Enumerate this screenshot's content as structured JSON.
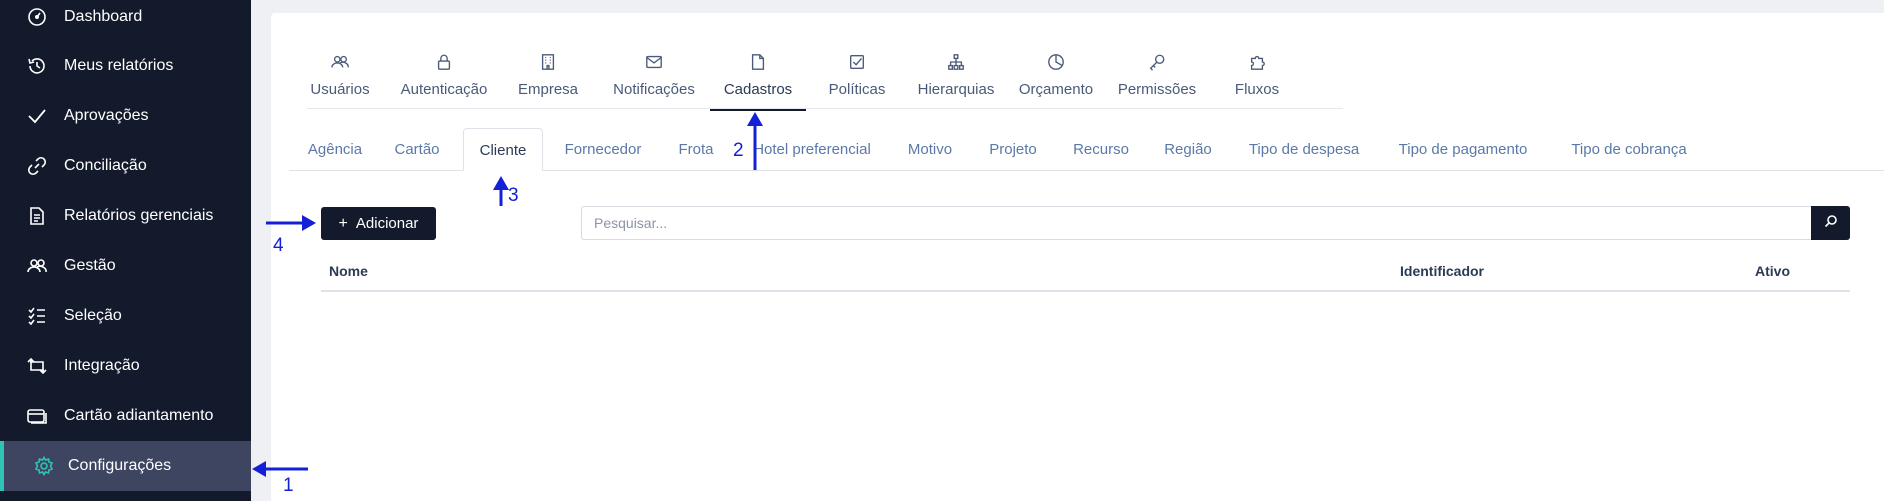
{
  "sidebar": {
    "items": [
      {
        "label": "Dashboard",
        "icon": "dashboard-gauge-icon"
      },
      {
        "label": "Meus relatórios",
        "icon": "history-icon"
      },
      {
        "label": "Aprovações",
        "icon": "check-icon"
      },
      {
        "label": "Conciliação",
        "icon": "link-icon"
      },
      {
        "label": "Relatórios gerenciais",
        "icon": "document-icon"
      },
      {
        "label": "Gestão",
        "icon": "users-icon"
      },
      {
        "label": "Seleção",
        "icon": "checklist-icon"
      },
      {
        "label": "Integração",
        "icon": "sync-icon"
      },
      {
        "label": "Cartão adiantamento",
        "icon": "card-icon"
      },
      {
        "label": "Configurações",
        "icon": "gear-icon",
        "active": true
      }
    ]
  },
  "top_tabs": [
    {
      "label": "Usuários",
      "icon": "users-icon"
    },
    {
      "label": "Autenticação",
      "icon": "lock-icon"
    },
    {
      "label": "Empresa",
      "icon": "building-icon"
    },
    {
      "label": "Notificações",
      "icon": "mail-icon"
    },
    {
      "label": "Cadastros",
      "icon": "file-icon",
      "active": true
    },
    {
      "label": "Políticas",
      "icon": "checkbox-icon"
    },
    {
      "label": "Hierarquias",
      "icon": "sitemap-icon"
    },
    {
      "label": "Orçamento",
      "icon": "pie-chart-icon"
    },
    {
      "label": "Permissões",
      "icon": "key-icon"
    },
    {
      "label": "Fluxos",
      "icon": "puzzle-icon"
    }
  ],
  "sub_tabs": [
    {
      "label": "Agência"
    },
    {
      "label": "Cartão"
    },
    {
      "label": "Cliente",
      "active": true
    },
    {
      "label": "Fornecedor"
    },
    {
      "label": "Frota"
    },
    {
      "label": "Hotel preferencial"
    },
    {
      "label": "Motivo"
    },
    {
      "label": "Projeto"
    },
    {
      "label": "Recurso"
    },
    {
      "label": "Região"
    },
    {
      "label": "Tipo de despesa"
    },
    {
      "label": "Tipo de pagamento"
    },
    {
      "label": "Tipo de cobrança"
    }
  ],
  "toolbar": {
    "add_label": "Adicionar",
    "search_placeholder": "Pesquisar...",
    "search_value": ""
  },
  "table": {
    "columns": [
      "Nome",
      "Identificador",
      "Ativo"
    ],
    "rows": []
  },
  "annotations": [
    "1",
    "2",
    "3",
    "4"
  ],
  "colors": {
    "sidebar_bg": "#131a2b",
    "active_item_bg": "#3d4560",
    "accent": "#2ec4b6",
    "subtab_link": "#5b79a8",
    "annotation": "#1320d6"
  }
}
